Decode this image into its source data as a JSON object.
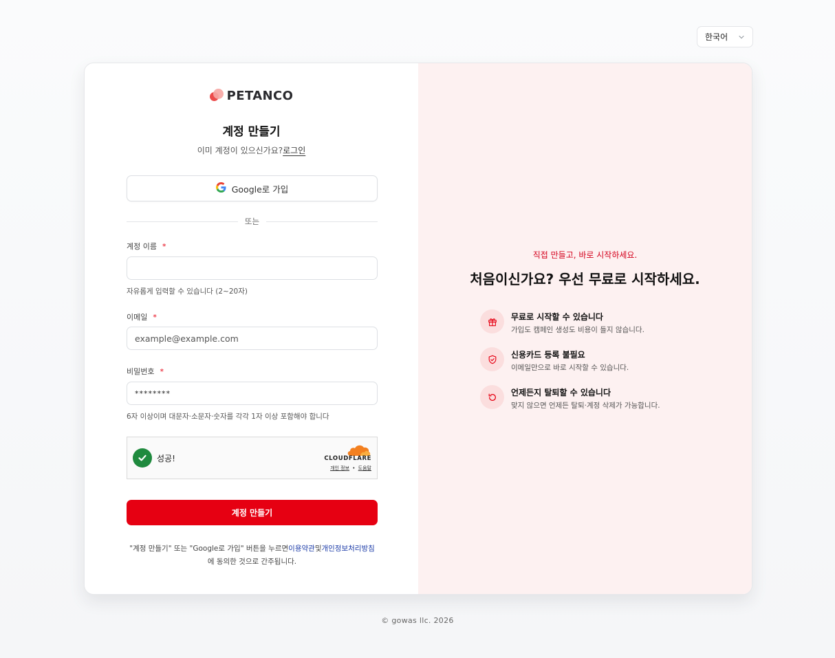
{
  "language": {
    "selected": "한국어"
  },
  "brand": {
    "name": "PETANCO"
  },
  "signup": {
    "title": "계정 만들기",
    "have_account_text": "이미 계정이 있으신가요?",
    "login_link": "로그인",
    "google_button": "Google로 가입",
    "divider_text": "또는",
    "account_name": {
      "label": "계정 이름",
      "value": "",
      "hint": "자유롭게 입력할 수 있습니다 (2~20자)"
    },
    "email": {
      "label": "이메일",
      "placeholder": "example@example.com"
    },
    "password": {
      "label": "비밀번호",
      "value": "********",
      "hint": "6자 이상이며 대문자·소문자·숫자를 각각 1자 이상 포함해야 합니다"
    },
    "required_mark": "*",
    "captcha": {
      "status": "성공!",
      "provider": "CLOUDFLARE",
      "privacy_link": "개인 정보",
      "help_link": "도움말",
      "separator": "•"
    },
    "submit_button": "계정 만들기",
    "terms": {
      "prefix": "\"계정 만들기\" 또는 \"Google로 가입\" 버튼을 누르면",
      "terms_link": "이용약관",
      "conjunction": "및",
      "privacy_link": "개인정보처리방침",
      "suffix": "에 동의한 것으로 간주됩니다."
    }
  },
  "promo": {
    "eyebrow": "직접 만들고, 바로 시작하세요.",
    "title": "처음이신가요? 우선 무료로 시작하세요.",
    "features": [
      {
        "icon": "gift-icon",
        "title": "무료로 시작할 수 있습니다",
        "desc": "가입도 캠페인 생성도 비용이 들지 않습니다."
      },
      {
        "icon": "shield-check-icon",
        "title": "신용카드 등록 불필요",
        "desc": "이메일만으로 바로 시작할 수 있습니다."
      },
      {
        "icon": "rotate-icon",
        "title": "언제든지 탈퇴할 수 있습니다",
        "desc": "맞지 않으면 언제든 탈퇴·계정 삭제가 가능합니다."
      }
    ]
  },
  "footer": {
    "copyright": "©  gowas llc. 2026"
  },
  "colors": {
    "accent": "#e60012",
    "promo_bg": "#fdf1f1",
    "icon_bg": "#fbdede",
    "link": "#1d3ca8",
    "captcha_success": "#1f8a3e"
  }
}
